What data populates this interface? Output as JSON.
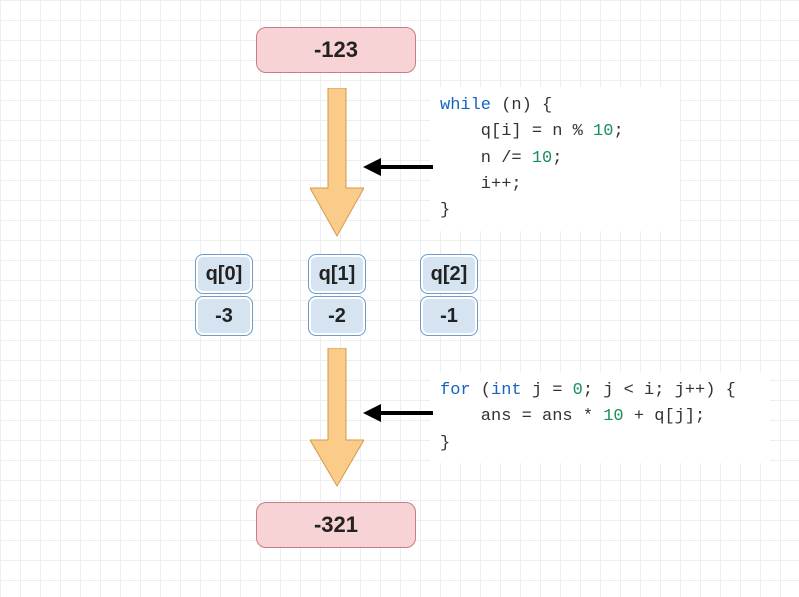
{
  "input": "-123",
  "output": "-321",
  "q": [
    {
      "label": "q[0]",
      "value": "-3"
    },
    {
      "label": "q[1]",
      "value": "-2"
    },
    {
      "label": "q[2]",
      "value": "-1"
    }
  ],
  "code1": {
    "l1a": "while",
    "l1b": " (n) {",
    "l2a": "    q[i] = n % ",
    "l2b": "10",
    "l2c": ";",
    "l3a": "    n /= ",
    "l3b": "10",
    "l3c": ";",
    "l4": "    i++;",
    "l5": "}"
  },
  "code2": {
    "l1a": "for",
    "l1b": " (",
    "l1c": "int",
    "l1d": " j = ",
    "l1e": "0",
    "l1f": "; j < i; j++) {",
    "l2a": "    ans = ans * ",
    "l2b": "10",
    "l2c": " + q[j];",
    "l3": "}"
  }
}
